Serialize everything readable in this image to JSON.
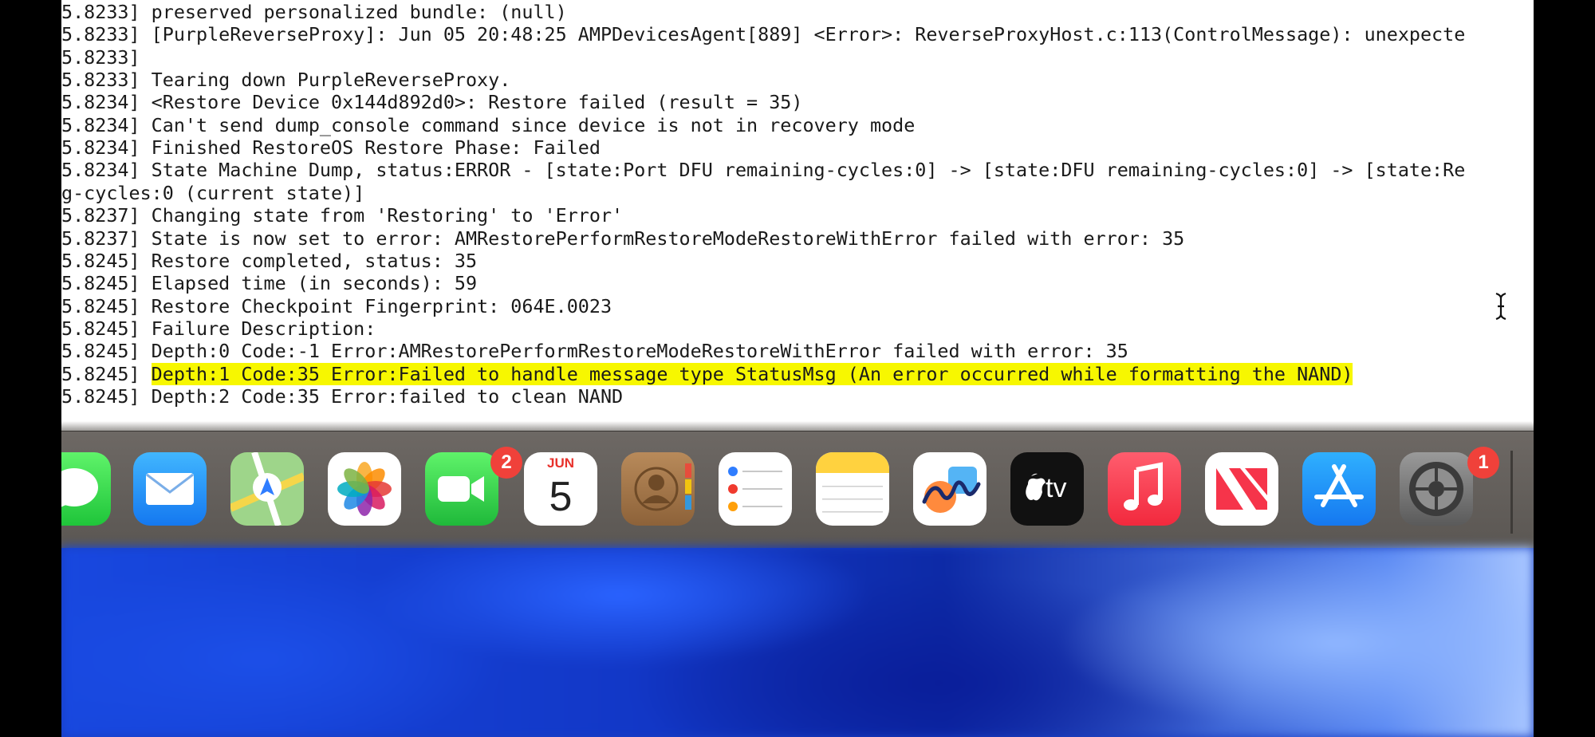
{
  "terminal": {
    "log_lines": [
      {
        "prefix": "5.8233]",
        "text": "preserved personalized bundle: (null)",
        "highlight": false
      },
      {
        "prefix": "5.8233]",
        "text": "[PurpleReverseProxy]: Jun 05 20:48:25 AMPDevicesAgent[889] <Error>: ReverseProxyHost.c:113(ControlMessage): unexpecte",
        "highlight": false
      },
      {
        "prefix": "5.8233]",
        "text": "",
        "highlight": false
      },
      {
        "prefix": "5.8233]",
        "text": "Tearing down PurpleReverseProxy.",
        "highlight": false
      },
      {
        "prefix": "5.8234]",
        "text": "<Restore Device 0x144d892d0>: Restore failed (result = 35)",
        "highlight": false
      },
      {
        "prefix": "5.8234]",
        "text": "Can't send dump_console command since device is not in recovery mode",
        "highlight": false
      },
      {
        "prefix": "5.8234]",
        "text": "Finished RestoreOS Restore Phase: Failed",
        "highlight": false
      },
      {
        "prefix": "5.8234]",
        "text": "State Machine Dump, status:ERROR - [state:Port DFU remaining-cycles:0] -> [state:DFU remaining-cycles:0] -> [state:Re",
        "highlight": false
      },
      {
        "prefix": "",
        "text": "g-cycles:0 (current state)]",
        "highlight": false
      },
      {
        "prefix": "5.8237]",
        "text": "Changing state from 'Restoring' to 'Error'",
        "highlight": false
      },
      {
        "prefix": "5.8237]",
        "text": "State is now set to error: AMRestorePerformRestoreModeRestoreWithError failed with error: 35",
        "highlight": false
      },
      {
        "prefix": "5.8245]",
        "text": "Restore completed, status: 35",
        "highlight": false
      },
      {
        "prefix": "5.8245]",
        "text": "Elapsed time (in seconds): 59",
        "highlight": false
      },
      {
        "prefix": "5.8245]",
        "text": "Restore Checkpoint Fingerprint: 064E.0023",
        "highlight": false
      },
      {
        "prefix": "5.8245]",
        "text": "Failure Description:",
        "highlight": false
      },
      {
        "prefix": "5.8245]",
        "text": "Depth:0 Code:-1 Error:AMRestorePerformRestoreModeRestoreWithError failed with error: 35",
        "highlight": false
      },
      {
        "prefix": "5.8245]",
        "text": "Depth:1 Code:35 Error:Failed to handle message type StatusMsg (An error occurred while formatting the NAND)",
        "highlight": true
      },
      {
        "prefix": "5.8245]",
        "text": "Depth:2 Code:35 Error:failed to clean NAND",
        "highlight": false
      }
    ]
  },
  "dock": {
    "apps": [
      {
        "name": "Messages",
        "icon": "messages-icon",
        "badge": ""
      },
      {
        "name": "Mail",
        "icon": "mail-icon",
        "badge": ""
      },
      {
        "name": "Maps",
        "icon": "maps-icon",
        "badge": ""
      },
      {
        "name": "Photos",
        "icon": "photos-icon",
        "badge": ""
      },
      {
        "name": "FaceTime",
        "icon": "facetime-icon",
        "badge": "2"
      },
      {
        "name": "Calendar",
        "icon": "calendar-icon",
        "badge": "",
        "month": "JUN",
        "day": "5"
      },
      {
        "name": "Contacts",
        "icon": "contacts-icon",
        "badge": ""
      },
      {
        "name": "Reminders",
        "icon": "reminders-icon",
        "badge": ""
      },
      {
        "name": "Notes",
        "icon": "notes-icon",
        "badge": ""
      },
      {
        "name": "Freeform",
        "icon": "freeform-icon",
        "badge": ""
      },
      {
        "name": "TV",
        "icon": "apple-tv-icon",
        "badge": "",
        "label": "tv"
      },
      {
        "name": "Music",
        "icon": "music-icon",
        "badge": ""
      },
      {
        "name": "News",
        "icon": "news-icon",
        "badge": ""
      },
      {
        "name": "App Store",
        "icon": "app-store-icon",
        "badge": ""
      },
      {
        "name": "System Settings",
        "icon": "system-settings-icon",
        "badge": "1"
      }
    ]
  },
  "colors": {
    "highlight": "#f7f700",
    "badge": "#f0413a",
    "dock": "#66625e",
    "terminal_background": "#ffffff",
    "terminal_text": "#1a1a1a"
  }
}
